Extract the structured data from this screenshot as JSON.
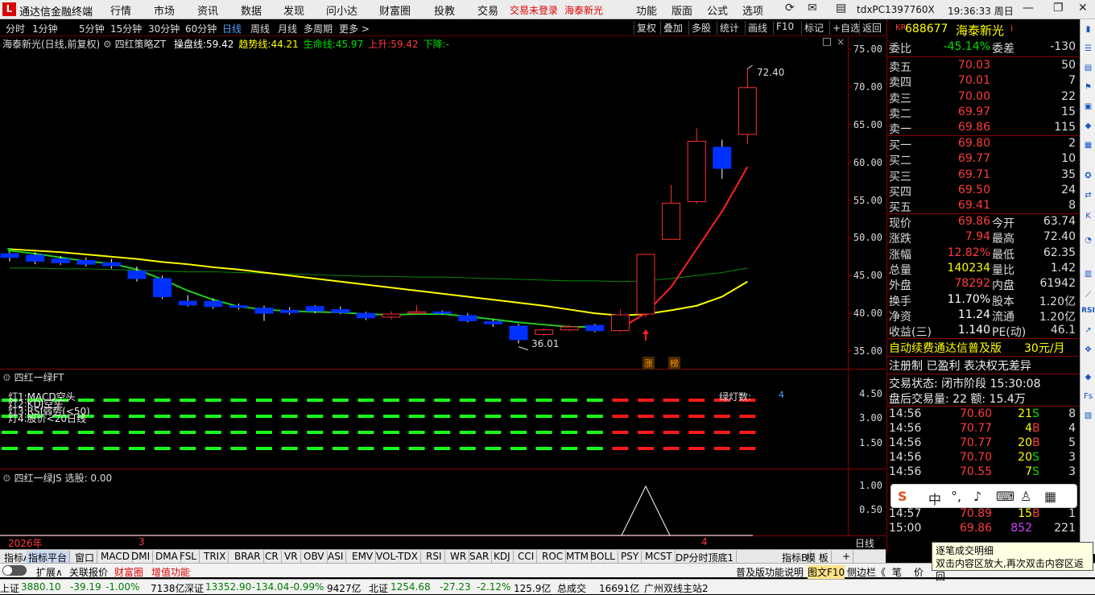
{
  "app": {
    "title": "通达信金融终端",
    "menu": [
      "行情",
      "市场",
      "资讯",
      "数据",
      "发现",
      "问小达",
      "财富圈",
      "投教",
      "交易"
    ],
    "trade_status": "交易未登录",
    "stock_link": "海泰新光",
    "right_menu": [
      "功能",
      "版面",
      "公式",
      "选项"
    ],
    "pc_name": "tdxPC1397760X",
    "clock": "19:36:33 周日"
  },
  "toolbar": {
    "periods": [
      "分时",
      "1分钟",
      "5分钟",
      "15分钟",
      "30分钟",
      "60分钟",
      "日线",
      "周线",
      "月线",
      "多周期",
      "更多 >"
    ],
    "active_period": "日线",
    "right_buttons": [
      "复权",
      "叠加",
      "多股",
      "统计",
      "画线",
      "F10",
      "标记",
      "+自选",
      "返回"
    ]
  },
  "main_chart": {
    "stock_label": "海泰新光(日线,前复权)",
    "indicator_name": "四红策略ZT",
    "legend": [
      {
        "label": "操盘线:",
        "value": "59.42",
        "color": "#ffffff"
      },
      {
        "label": "趋势线:",
        "value": "44.21",
        "color": "#ffff00"
      },
      {
        "label": "生命线:",
        "value": "45.97",
        "color": "#00e000"
      },
      {
        "label": "上升:",
        "value": "59.42",
        "color": "#ff3b3b"
      },
      {
        "label": "下降:",
        "value": "-",
        "color": "#00e000"
      }
    ],
    "y_ticks": [
      "75.00",
      "70.00",
      "65.00",
      "60.00",
      "55.00",
      "50.00",
      "45.00",
      "40.00",
      "35.00"
    ],
    "high_label": "72.40",
    "low_label": "36.01",
    "markers": [
      "涨",
      "榜"
    ]
  },
  "chart_data": {
    "type": "candlestick",
    "ylim": [
      34,
      76
    ],
    "candles": [
      {
        "o": 47.9,
        "c": 47.4,
        "h": 48.6,
        "l": 46.9
      },
      {
        "o": 47.7,
        "c": 46.9,
        "h": 48.1,
        "l": 46.5
      },
      {
        "o": 47.2,
        "c": 46.7,
        "h": 47.6,
        "l": 46.4
      },
      {
        "o": 47.0,
        "c": 46.5,
        "h": 47.4,
        "l": 46.2
      },
      {
        "o": 46.7,
        "c": 46.3,
        "h": 47.2,
        "l": 45.9
      },
      {
        "o": 45.6,
        "c": 44.6,
        "h": 46.2,
        "l": 44.2
      },
      {
        "o": 44.6,
        "c": 42.2,
        "h": 45.0,
        "l": 41.9
      },
      {
        "o": 41.6,
        "c": 41.1,
        "h": 42.4,
        "l": 40.9
      },
      {
        "o": 41.6,
        "c": 40.9,
        "h": 42.0,
        "l": 40.6
      },
      {
        "o": 41.0,
        "c": 40.8,
        "h": 41.3,
        "l": 40.5
      },
      {
        "o": 40.7,
        "c": 40.0,
        "h": 41.0,
        "l": 39.0
      },
      {
        "o": 40.4,
        "c": 40.1,
        "h": 40.8,
        "l": 39.8
      },
      {
        "o": 40.9,
        "c": 40.3,
        "h": 41.1,
        "l": 40.0
      },
      {
        "o": 40.5,
        "c": 40.1,
        "h": 40.9,
        "l": 39.9
      },
      {
        "o": 40.0,
        "c": 39.4,
        "h": 40.2,
        "l": 39.1
      },
      {
        "o": 39.5,
        "c": 39.9,
        "h": 40.3,
        "l": 39.2
      },
      {
        "o": 40.0,
        "c": 40.2,
        "h": 41.1,
        "l": 39.9
      },
      {
        "o": 40.2,
        "c": 40.0,
        "h": 40.4,
        "l": 39.8
      },
      {
        "o": 39.7,
        "c": 39.0,
        "h": 40.0,
        "l": 38.8
      },
      {
        "o": 38.9,
        "c": 38.6,
        "h": 39.2,
        "l": 38.2
      },
      {
        "o": 38.3,
        "c": 36.5,
        "h": 38.6,
        "l": 36.0
      },
      {
        "o": 37.2,
        "c": 37.8,
        "h": 38.0,
        "l": 37.0
      },
      {
        "o": 37.8,
        "c": 38.2,
        "h": 38.5,
        "l": 37.6
      },
      {
        "o": 38.4,
        "c": 37.7,
        "h": 38.6,
        "l": 37.5
      },
      {
        "o": 37.7,
        "c": 39.8,
        "h": 40.5,
        "l": 37.5
      },
      {
        "o": 39.9,
        "c": 47.8,
        "h": 47.9,
        "l": 39.5
      },
      {
        "o": 49.8,
        "c": 54.6,
        "h": 57.0,
        "l": 49.7
      },
      {
        "o": 54.8,
        "c": 62.8,
        "h": 64.5,
        "l": 54.5
      },
      {
        "o": 62.0,
        "c": 59.2,
        "h": 63.0,
        "l": 57.8
      },
      {
        "o": 63.7,
        "c": 69.9,
        "h": 72.4,
        "l": 62.4
      }
    ],
    "lines": {
      "趋势线": [
        48.5,
        48.3,
        48.1,
        47.8,
        47.5,
        47.2,
        46.8,
        46.5,
        46.1,
        45.8,
        45.4,
        45.0,
        44.6,
        44.2,
        43.8,
        43.4,
        43.0,
        42.6,
        42.2,
        41.8,
        41.4,
        41.0,
        40.5,
        40.0,
        39.7,
        39.9,
        40.4,
        41.0,
        42.2,
        44.2
      ],
      "生命线": [
        48.3,
        47.9,
        47.4,
        46.9,
        46.6,
        45.8,
        44.5,
        43.0,
        41.8,
        40.9,
        40.5,
        40.3,
        40.2,
        40.1,
        39.9,
        39.8,
        39.9,
        39.9,
        39.6,
        39.2,
        38.8,
        38.5,
        38.2,
        38.2
      ],
      "上升": [
        38.0,
        40.0,
        43.5,
        48.5,
        53.5,
        59.4
      ],
      "ref_green": [
        46.0,
        46.0,
        45.9,
        45.9,
        45.8,
        45.7,
        45.6,
        45.5,
        45.5,
        45.4,
        45.3,
        45.2,
        45.1,
        45.0,
        44.9,
        44.9,
        44.8,
        44.8,
        44.7,
        44.6,
        44.5,
        44.4,
        44.3,
        44.3,
        44.2,
        44.3,
        44.6,
        45.0,
        45.4,
        46.0
      ]
    },
    "ft_rows": [
      "灯1:MACD空头",
      "灯2:KDJ空头",
      "灯3:RSI弱势(<50)",
      "灯4:股价<20日线"
    ],
    "ft_red_from": 24,
    "js_spike_index": 25
  },
  "pane2": {
    "title": "四红一绿FT",
    "lamp_label": "绿灯数:",
    "lamp_value": "4",
    "y_ticks": [
      "4.50",
      "3.00",
      "1.50"
    ]
  },
  "pane3": {
    "title": "四红一绿JS",
    "sub": "选股: 0.00",
    "y_ticks": [
      "1.00",
      "0.50"
    ],
    "x_axis": [
      "2026年",
      "3",
      "4"
    ],
    "x_right": "日线"
  },
  "quote": {
    "code": "688677",
    "name": "海泰新光",
    "weibi_label": "委比",
    "weibi": "-45.14%",
    "weicha_label": "委差",
    "weicha": "-130",
    "asks": [
      {
        "label": "卖五",
        "price": "70.03",
        "vol": "50"
      },
      {
        "label": "卖四",
        "price": "70.01",
        "vol": "7"
      },
      {
        "label": "卖三",
        "price": "70.00",
        "vol": "22"
      },
      {
        "label": "卖二",
        "price": "69.97",
        "vol": "15"
      },
      {
        "label": "卖一",
        "price": "69.86",
        "vol": "115"
      }
    ],
    "bids": [
      {
        "label": "买一",
        "price": "69.80",
        "vol": "2"
      },
      {
        "label": "买二",
        "price": "69.77",
        "vol": "10"
      },
      {
        "label": "买三",
        "price": "69.71",
        "vol": "35"
      },
      {
        "label": "买四",
        "price": "69.50",
        "vol": "24"
      },
      {
        "label": "买五",
        "price": "69.41",
        "vol": "8"
      }
    ],
    "stats": [
      {
        "l": "现价",
        "v": "69.86",
        "vc": "red",
        "l2": "今开",
        "v2": "63.74",
        "v2c": "red"
      },
      {
        "l": "涨跌",
        "v": "7.94",
        "vc": "red",
        "l2": "最高",
        "v2": "72.40",
        "v2c": "red"
      },
      {
        "l": "涨幅",
        "v": "12.82%",
        "vc": "red",
        "l2": "最低",
        "v2": "62.35",
        "v2c": "red"
      },
      {
        "l": "总量",
        "v": "140234",
        "vc": "yellow",
        "l2": "量比",
        "v2": "1.42",
        "v2c": "red"
      },
      {
        "l": "外盘",
        "v": "78292",
        "vc": "red",
        "l2": "内盘",
        "v2": "61942",
        "v2c": "green"
      },
      {
        "l": "换手",
        "v": "11.70%",
        "vc": "white",
        "l2": "股本",
        "v2": "1.20亿",
        "v2c": "white"
      },
      {
        "l": "净资",
        "v": "11.24",
        "vc": "white",
        "l2": "流通",
        "v2": "1.20亿",
        "v2c": "white"
      },
      {
        "l": "收益(三)",
        "v": "1.140",
        "vc": "white",
        "l2": "PE(动)",
        "v2": "46.1",
        "v2c": "white"
      }
    ],
    "ad1": "自动续费通达信普及版",
    "ad1b": "30元/月",
    "ad2": "注册制 已盈利 表决权无差异",
    "trade_state": "交易状态: 闭市阶段 15:30:08",
    "after_hours": "盘后交易量: 22  额: 15.4万",
    "ticks": [
      {
        "t": "14:56",
        "p": "70.60",
        "v": "21",
        "s": "S",
        "n": "8"
      },
      {
        "t": "14:56",
        "p": "70.77",
        "v": "4",
        "s": "B",
        "n": "4"
      },
      {
        "t": "14:56",
        "p": "70.77",
        "v": "20",
        "s": "B",
        "n": "5"
      },
      {
        "t": "14:56",
        "p": "70.70",
        "v": "20",
        "s": "S",
        "n": "3"
      },
      {
        "t": "14:56",
        "p": "70.55",
        "v": "7",
        "s": "S",
        "n": "3"
      },
      {
        "t": "14:57",
        "p": "70.89",
        "v": "15",
        "s": "B",
        "n": "1"
      },
      {
        "t": "15:00",
        "p": "69.86",
        "v": "852",
        "s": "",
        "n": "221"
      }
    ]
  },
  "bottom_tabs": [
    "指标A",
    "指标平台",
    "窗口",
    "MACD",
    "DMI",
    "DMA",
    "FSL",
    "TRIX",
    "BRAR",
    "CR",
    "VR",
    "OBV",
    "ASI",
    "EMV",
    "VOL-TDX",
    "RSI",
    "WR",
    "SAR",
    "KDJ",
    "CCI",
    "ROC",
    "MTM",
    "BOLL",
    "PSY",
    "MCST",
    "DP分时顶底1",
    "指标B",
    "模 板",
    "+"
  ],
  "status1": {
    "items": [
      "扩展∧",
      "关联报价",
      "财富圈",
      "增值功能"
    ],
    "right": [
      "普及版功能说明",
      "图文F10",
      "侧边栏《",
      "笔",
      "价"
    ]
  },
  "status2": {
    "sh_label": "上证",
    "sh": "3880.10",
    "sh_chg": "-39.19",
    "sh_pct": "-1.00%",
    "sh_amt": "7138亿",
    "sz_label": "深证",
    "sz": "13352.90",
    "sz_chg": "-134.04",
    "sz_pct": "-0.99%",
    "sz_amt": "9427亿",
    "bz_label": "北证",
    "bz": "1254.68",
    "bz_chg": "-27.23",
    "bz_pct": "-2.12%",
    "bz_amt": "125.9亿",
    "total_label": "总成交",
    "total": "16691亿",
    "server": "广州双线主站2"
  },
  "tooltip": {
    "line1": "逐笔成交明细",
    "line2": "双击内容区放大,再次双击内容区返回"
  },
  "ime": [
    "S",
    "中",
    "°,",
    "mic",
    "kbd",
    "shirt",
    "grid"
  ]
}
